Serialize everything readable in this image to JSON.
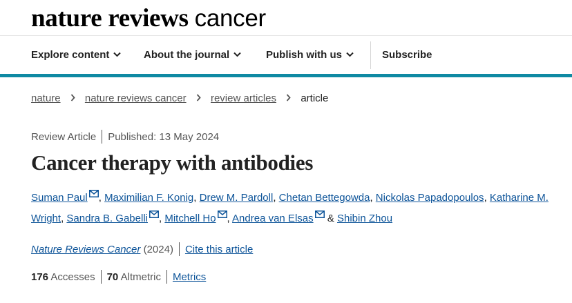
{
  "brand": {
    "bold_text": "nature reviews",
    "light_text": "cancer"
  },
  "nav": {
    "items": [
      {
        "label": "Explore content"
      },
      {
        "label": "About the journal"
      },
      {
        "label": "Publish with us"
      }
    ],
    "subscribe": "Subscribe",
    "accent_color": "#0f8aa3"
  },
  "breadcrumb": {
    "items": [
      "nature",
      "nature reviews cancer",
      "review articles"
    ],
    "current": "article"
  },
  "article": {
    "type": "Review Article",
    "published": "Published: 13 May 2024",
    "title": "Cancer therapy with antibodies",
    "authors": [
      {
        "name": "Suman Paul",
        "email_icon": true
      },
      {
        "name": "Maximilian F. Konig",
        "email_icon": false
      },
      {
        "name": "Drew M. Pardoll",
        "email_icon": false
      },
      {
        "name": "Chetan Bettegowda",
        "email_icon": false
      },
      {
        "name": "Nickolas Papadopoulos",
        "email_icon": false
      },
      {
        "name": "Katharine M. Wright",
        "email_icon": false
      },
      {
        "name": "Sandra B. Gabelli",
        "email_icon": true
      },
      {
        "name": "Mitchell Ho",
        "email_icon": true
      },
      {
        "name": "Andrea van Elsas",
        "email_icon": true
      },
      {
        "name": "Shibin Zhou",
        "email_icon": false
      }
    ],
    "and_text": "&",
    "journal": "Nature Reviews Cancer",
    "year": "(2024)",
    "cite": "Cite this article",
    "accesses_count": "176",
    "accesses_label": "Accesses",
    "altmetric_count": "70",
    "altmetric_label": "Altmetric",
    "metrics_link": "Metrics",
    "link_color": "#0d5499"
  }
}
